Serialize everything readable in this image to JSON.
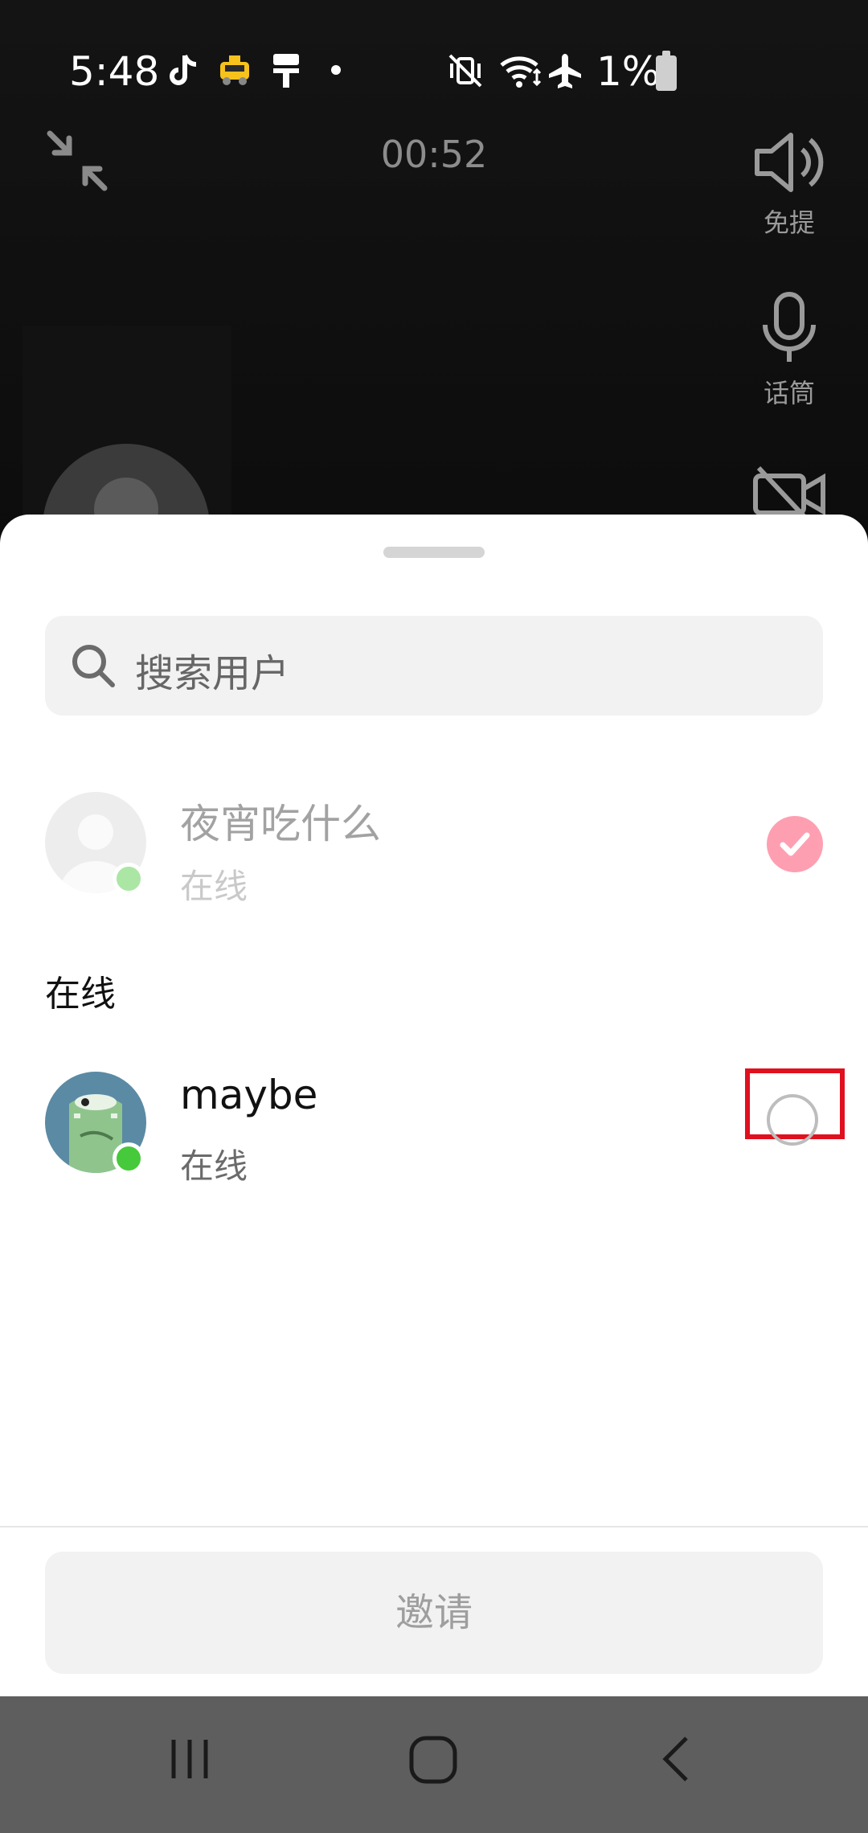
{
  "status_bar": {
    "time": "5:48",
    "battery": "1%",
    "icons": [
      "tiktok-icon",
      "taxi-icon",
      "paint-roller-icon",
      "dot-icon",
      "vibrate-mute-icon",
      "wifi-icon",
      "airplane-icon",
      "battery-icon"
    ]
  },
  "call": {
    "timer": "00:52",
    "controls": {
      "speaker_label": "免提",
      "mic_label": "话筒"
    }
  },
  "sheet": {
    "search_placeholder": "搜索用户",
    "selected_user": {
      "name": "夜宵吃什么",
      "status": "在线",
      "selected": true
    },
    "section_title": "在线",
    "users": [
      {
        "name": "maybe",
        "status": "在线",
        "selected": false
      }
    ],
    "invite_label": "邀请"
  },
  "colors": {
    "accent": "#fe2c55",
    "online": "#46c93a",
    "highlight": "#e0101f"
  }
}
